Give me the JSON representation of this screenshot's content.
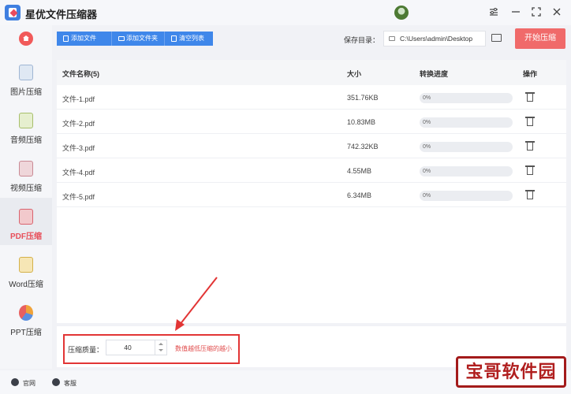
{
  "app": {
    "title": "星优文件压缩器"
  },
  "colors": {
    "accent": "#3f87ea",
    "danger": "#f06a6a",
    "active_text": "#e8505b"
  },
  "sidebar": {
    "home_icon": "home-icon",
    "items": [
      {
        "label": "图片压缩",
        "icon": "image-icon",
        "active": false
      },
      {
        "label": "音频压缩",
        "icon": "music-icon",
        "active": false
      },
      {
        "label": "视频压缩",
        "icon": "video-icon",
        "active": false
      },
      {
        "label": "PDF压缩",
        "icon": "pdf-icon",
        "active": true
      },
      {
        "label": "Word压缩",
        "icon": "word-icon",
        "active": false
      },
      {
        "label": "PPT压缩",
        "icon": "ppt-icon",
        "active": false
      }
    ]
  },
  "toolbar": {
    "add_file": "添加文件",
    "add_folder": "添加文件夹",
    "clear_list": "清空列表",
    "save_dir_label": "保存目录：",
    "save_dir_value": "C:\\Users\\admin\\Desktop",
    "start": "开始压缩"
  },
  "table": {
    "headers": {
      "name": "文件名称(5)",
      "size": "大小",
      "progress": "转换进度",
      "action": "操作"
    },
    "rows": [
      {
        "name": "文件-1.pdf",
        "size": "351.76KB",
        "progress": 0,
        "progress_text": "0%"
      },
      {
        "name": "文件-2.pdf",
        "size": "10.83MB",
        "progress": 0,
        "progress_text": "0%"
      },
      {
        "name": "文件-3.pdf",
        "size": "742.32KB",
        "progress": 0,
        "progress_text": "0%"
      },
      {
        "name": "文件-4.pdf",
        "size": "4.55MB",
        "progress": 0,
        "progress_text": "0%"
      },
      {
        "name": "文件-5.pdf",
        "size": "6.34MB",
        "progress": 0,
        "progress_text": "0%"
      }
    ]
  },
  "quality": {
    "label": "压缩质量：",
    "value": "40",
    "hint": "数值越低压缩的越小"
  },
  "footer": {
    "website": "官网",
    "support": "客服"
  },
  "watermark": {
    "text": "宝哥软件园"
  }
}
